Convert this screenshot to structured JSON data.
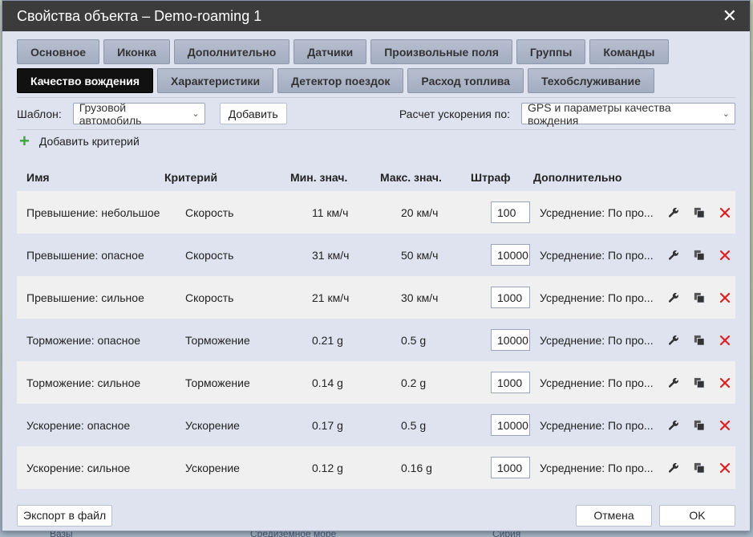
{
  "window": {
    "title": "Свойства объекта – Demo-roaming 1"
  },
  "tabs_row1": [
    "Основное",
    "Иконка",
    "Дополнительно",
    "Датчики",
    "Произвольные поля",
    "Группы",
    "Команды"
  ],
  "tabs_row2": [
    "Качество вождения",
    "Характеристики",
    "Детектор поездок",
    "Расход топлива",
    "Техобслуживание"
  ],
  "active_tab": "Качество вождения",
  "toolbar": {
    "template_label": "Шаблон:",
    "template_value": "Грузовой автомобиль",
    "add_button": "Добавить",
    "accel_label": "Расчет ускорения по:",
    "accel_value": "GPS и параметры качества вождения"
  },
  "add_criterion": "Добавить критерий",
  "columns": [
    "Имя",
    "Критерий",
    "Мин. знач.",
    "Макс. знач.",
    "Штраф",
    "Дополнительно"
  ],
  "rows": [
    {
      "name": "Превышение: небольшое",
      "criterion": "Скорость",
      "min": "11 км/ч",
      "max": "20 км/ч",
      "penalty": "100",
      "extra": "Усреднение: По про..."
    },
    {
      "name": "Превышение: опасное",
      "criterion": "Скорость",
      "min": "31 км/ч",
      "max": "50 км/ч",
      "penalty": "10000",
      "extra": "Усреднение: По про..."
    },
    {
      "name": "Превышение: сильное",
      "criterion": "Скорость",
      "min": "21 км/ч",
      "max": "30 км/ч",
      "penalty": "1000",
      "extra": "Усреднение: По про..."
    },
    {
      "name": "Торможение: опасное",
      "criterion": "Торможение",
      "min": "0.21 g",
      "max": "0.5 g",
      "penalty": "10000",
      "extra": "Усреднение: По про..."
    },
    {
      "name": "Торможение: сильное",
      "criterion": "Торможение",
      "min": "0.14 g",
      "max": "0.2 g",
      "penalty": "1000",
      "extra": "Усреднение: По про..."
    },
    {
      "name": "Ускорение: опасное",
      "criterion": "Ускорение",
      "min": "0.17 g",
      "max": "0.5 g",
      "penalty": "10000",
      "extra": "Усреднение: По про..."
    },
    {
      "name": "Ускорение: сильное",
      "criterion": "Ускорение",
      "min": "0.12 g",
      "max": "0.16 g",
      "penalty": "1000",
      "extra": "Усреднение: По про..."
    }
  ],
  "footer": {
    "export": "Экспорт в файл",
    "cancel": "Отмена",
    "ok": "OK"
  },
  "colors": {
    "titlebar": "#3c3c3c",
    "active_tab": "#111111",
    "delete": "#e02020",
    "plus": "#3ba63b"
  }
}
